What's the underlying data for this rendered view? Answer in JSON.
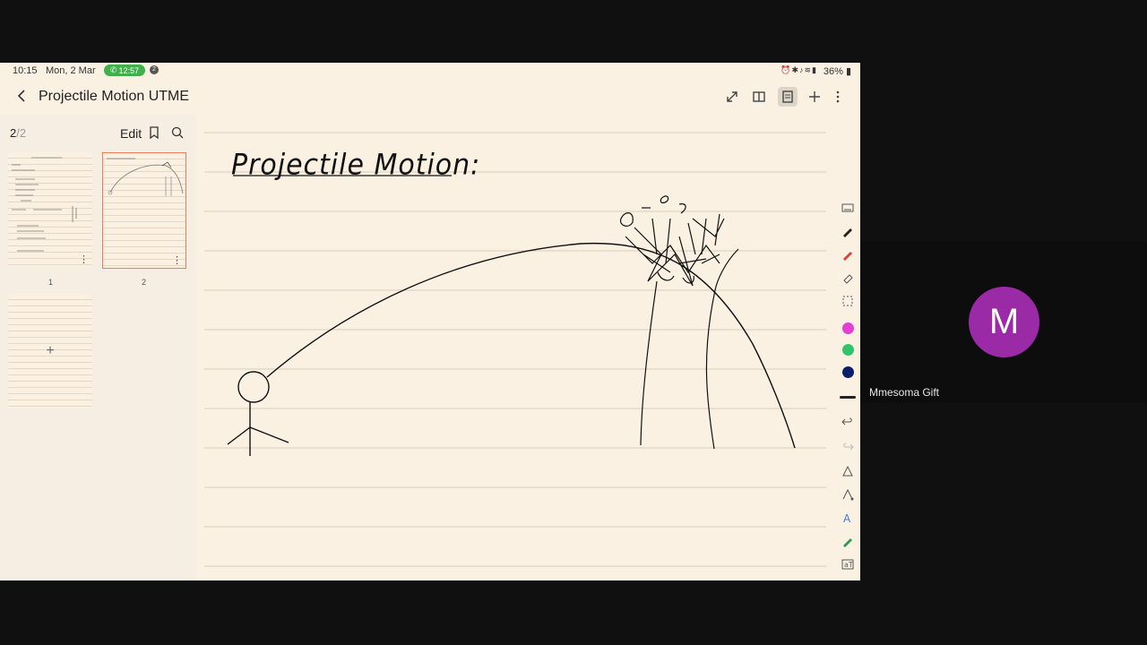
{
  "status_bar": {
    "time": "10:15",
    "date": "Mon, 2 Mar",
    "call_timer": "12:57",
    "notification_count": "2",
    "battery": "36%"
  },
  "toolbar": {
    "title": "Projectile Motion UTME",
    "tools": [
      "expand-icon",
      "book-view-icon",
      "page-view-icon",
      "add-icon",
      "more-vert-icon"
    ]
  },
  "sidebar": {
    "current_page": "2",
    "total_pages": "/2",
    "edit_label": "Edit",
    "pages": [
      {
        "number": "1",
        "selected": false
      },
      {
        "number": "2",
        "selected": true
      }
    ],
    "add_page_label": "+"
  },
  "canvas": {
    "heading": "Projectile Motion:"
  },
  "pen_tools": {
    "colors": [
      "#e33fd2",
      "#32c46a",
      "#0d1f6b"
    ],
    "accent": "#ef7b5a"
  },
  "participant": {
    "initial": "M",
    "name": "Mmesoma Gift",
    "avatar_color": "#9b2aa6"
  }
}
